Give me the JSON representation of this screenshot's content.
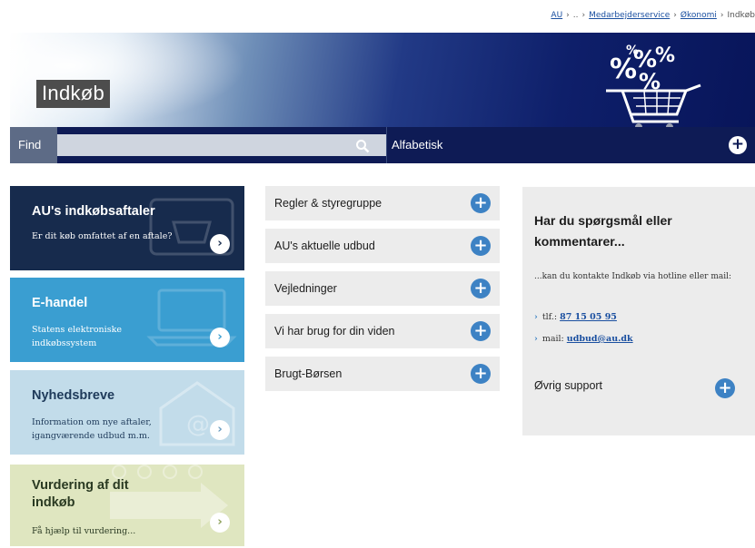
{
  "breadcrumb": {
    "items": [
      "AU",
      "..",
      "Medarbejderservice",
      "Økonomi",
      "Indkøb"
    ]
  },
  "banner": {
    "title": "Indkøb",
    "illustration_icon": "shopping-cart-percent-icon"
  },
  "search": {
    "label": "Find",
    "value": "",
    "placeholder": "",
    "icon": "search-icon",
    "alphabetical_label": "Alfabetisk"
  },
  "tiles": [
    {
      "title": "AU's indkøbsaftaler",
      "text": "Er dit køb omfattet af en aftale?"
    },
    {
      "title": "E-handel",
      "text": "Statens elektroniske indkøbssystem"
    },
    {
      "title": "Nyhedsbreve",
      "text": "Information om nye aftaler, igangværende udbud m.m."
    },
    {
      "title": "Vurdering af dit indkøb",
      "text": "Få hjælp til vurdering..."
    }
  ],
  "accordion": [
    {
      "label": "Regler & styregruppe"
    },
    {
      "label": "AU's aktuelle udbud"
    },
    {
      "label": "Vejledninger"
    },
    {
      "label": "Vi har brug for din viden"
    },
    {
      "label": "Brugt-Børsen"
    }
  ],
  "contact": {
    "heading": "Har du spørgsmål eller kommentarer...",
    "intro": "...kan du kontakte Indkøb via hotline eller mail:",
    "phone_prefix": "tlf.:",
    "phone": "87 15 05 95",
    "mail_prefix": "mail:",
    "mail": "udbud@au.dk",
    "support_label": "Øvrig support"
  },
  "colors": {
    "navy": "#0e1b55",
    "accent_blue": "#3d82c4",
    "tile1": "#172b4d",
    "tile2": "#3a9ed1",
    "tile3": "#c2dcea",
    "tile4": "#dfe6c0"
  }
}
